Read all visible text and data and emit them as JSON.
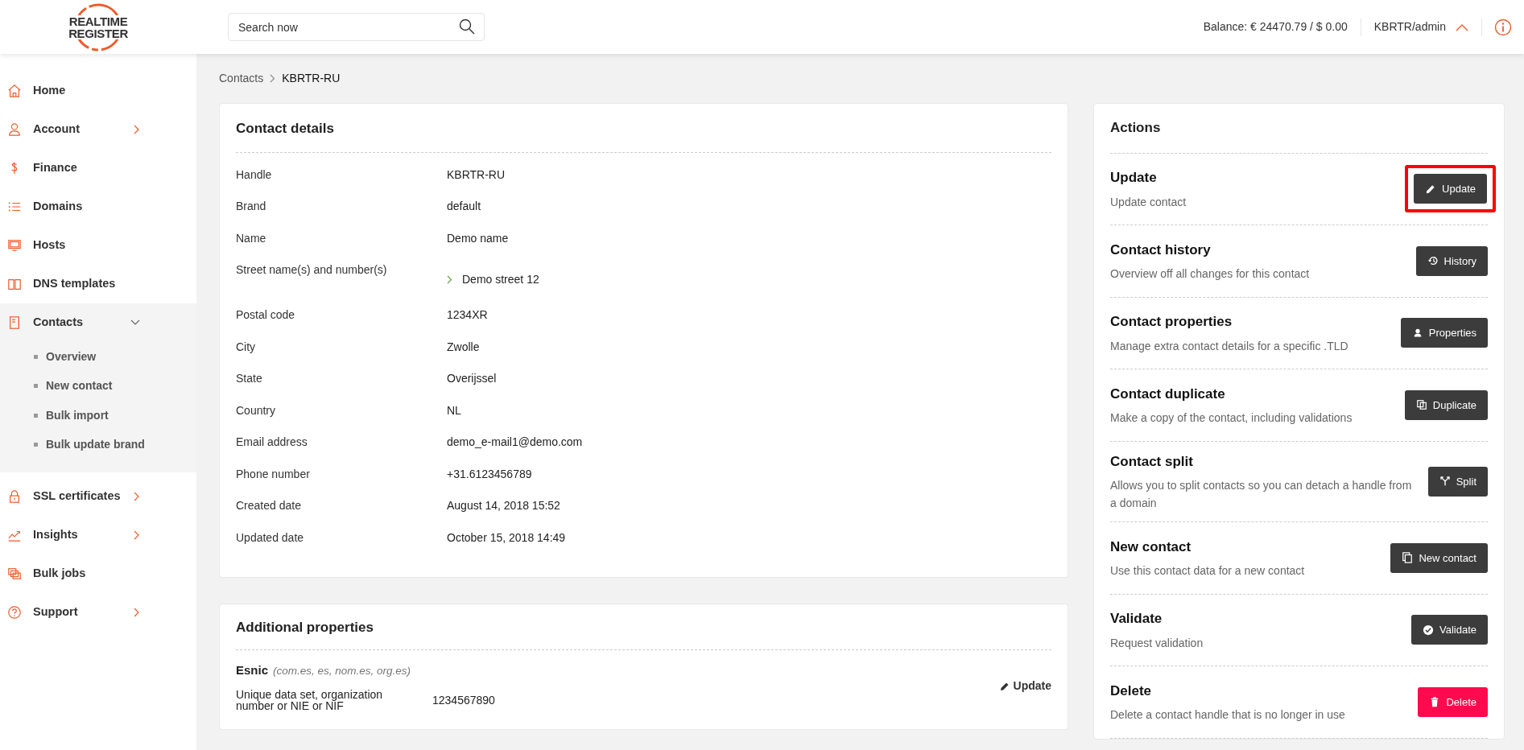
{
  "header": {
    "logo": [
      "REALTIME",
      "REGISTER"
    ],
    "search": {
      "placeholder": "Search now"
    },
    "balance": "Balance: € 24470.79 / $ 0.00",
    "user": "KBRTR/admin"
  },
  "sidebar": {
    "items": [
      {
        "label": "Home",
        "expandable": false
      },
      {
        "label": "Account",
        "expandable": true,
        "expanded": false
      },
      {
        "label": "Finance",
        "expandable": false
      },
      {
        "label": "Domains",
        "expandable": false
      },
      {
        "label": "Hosts",
        "expandable": false
      },
      {
        "label": "DNS templates",
        "expandable": false
      },
      {
        "label": "Contacts",
        "expandable": true,
        "expanded": true,
        "children": [
          {
            "label": "Overview"
          },
          {
            "label": "New contact"
          },
          {
            "label": "Bulk import"
          },
          {
            "label": "Bulk update brand"
          }
        ]
      },
      {
        "label": "SSL certificates",
        "expandable": true,
        "expanded": false
      },
      {
        "label": "Insights",
        "expandable": true,
        "expanded": false
      },
      {
        "label": "Bulk jobs",
        "expandable": false
      },
      {
        "label": "Support",
        "expandable": true,
        "expanded": false
      }
    ]
  },
  "breadcrumb": [
    "Contacts",
    "KBRTR-RU"
  ],
  "contact_details": {
    "title": "Contact details",
    "rows": [
      {
        "label": "Handle",
        "value": "KBRTR-RU",
        "expandable": false
      },
      {
        "label": "Brand",
        "value": "default",
        "expandable": false
      },
      {
        "label": "Name",
        "value": "Demo name",
        "expandable": false
      },
      {
        "label": "Street name(s) and number(s)",
        "value": "Demo street 12",
        "expandable": true
      },
      {
        "label": "Postal code",
        "value": "1234XR",
        "expandable": false
      },
      {
        "label": "City",
        "value": "Zwolle",
        "expandable": false
      },
      {
        "label": "State",
        "value": "Overijssel",
        "expandable": false
      },
      {
        "label": "Country",
        "value": "NL",
        "expandable": false
      },
      {
        "label": "Email address",
        "value": "demo_e-mail1@demo.com",
        "expandable": false
      },
      {
        "label": "Phone number",
        "value": "+31.6123456789",
        "expandable": false
      },
      {
        "label": "Created date",
        "value": "August 14, 2018 15:52",
        "expandable": false
      },
      {
        "label": "Updated date",
        "value": "October 15, 2018 14:49",
        "expandable": false
      }
    ]
  },
  "additional_properties": {
    "title": "Additional properties",
    "groups": [
      {
        "name": "Esnic",
        "tlds": "(com.es, es, nom.es, org.es)",
        "update": "Update",
        "rows": [
          {
            "label": "Unique data set, organization number or NIE or NIF",
            "value": "1234567890"
          }
        ]
      }
    ]
  },
  "actions": {
    "title": "Actions",
    "items": [
      {
        "title": "Update",
        "description": "Update contact",
        "button": "Update",
        "kind": "default",
        "highlighted": true
      },
      {
        "title": "Contact history",
        "description": "Overview off all changes for this contact",
        "button": "History",
        "kind": "default",
        "highlighted": false
      },
      {
        "title": "Contact properties",
        "description": "Manage extra contact details for a specific .TLD",
        "button": "Properties",
        "kind": "default",
        "highlighted": false
      },
      {
        "title": "Contact duplicate",
        "description": "Make a copy of the contact, including validations",
        "button": "Duplicate",
        "kind": "default",
        "highlighted": false
      },
      {
        "title": "Contact split",
        "description": "Allows you to split contacts so you can detach a handle from a domain",
        "button": "Split",
        "kind": "default",
        "highlighted": false
      },
      {
        "title": "New contact",
        "description": "Use this contact data for a new contact",
        "button": "New contact",
        "kind": "default",
        "highlighted": false
      },
      {
        "title": "Validate",
        "description": "Request validation",
        "button": "Validate",
        "kind": "default",
        "highlighted": false
      },
      {
        "title": "Delete",
        "description": "Delete a contact handle that is no longer in use",
        "button": "Delete",
        "kind": "danger",
        "highlighted": false
      }
    ]
  }
}
